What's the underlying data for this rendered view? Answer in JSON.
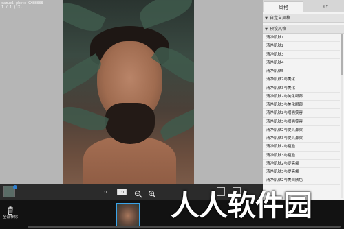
{
  "canvas": {
    "file_info": "samuel-photo-CX88888\n1 / 1 (1X)"
  },
  "toolbar": {
    "fit_label": "1:1",
    "actual_label": "1:1"
  },
  "panel": {
    "tabs": [
      {
        "label": "风格"
      },
      {
        "label": "DIY"
      }
    ],
    "groups": {
      "custom": "自定义风格",
      "preset": "预设风格"
    },
    "styles": [
      "清净肌肤1",
      "清净肌肤2",
      "清净肌肤3",
      "清净肌肤4",
      "清净肌肤5",
      "清净肌肤2与美化",
      "清净肌肤3与美化",
      "清净肌肤2与美化眼部",
      "清净肌肤3与美化眼部",
      "清净肌肤2与增强笑容",
      "清净肌肤3与增强笑容",
      "清净肌肤2与提亮鼻梁",
      "清净肌肤3与提亮鼻梁",
      "清净肌肤2与瘦脸",
      "清净肌肤3与瘦脸",
      "清净肌肤2与提亮颊",
      "清净肌肤3与提亮颊",
      "清净肌肤2与美白肤色"
    ]
  },
  "filmstrip": {
    "remove_all_label": "全部移除"
  },
  "watermark": "人人软件园",
  "colors": {
    "accent": "#3aa3e8",
    "panel_bg": "#f3f3f3"
  }
}
